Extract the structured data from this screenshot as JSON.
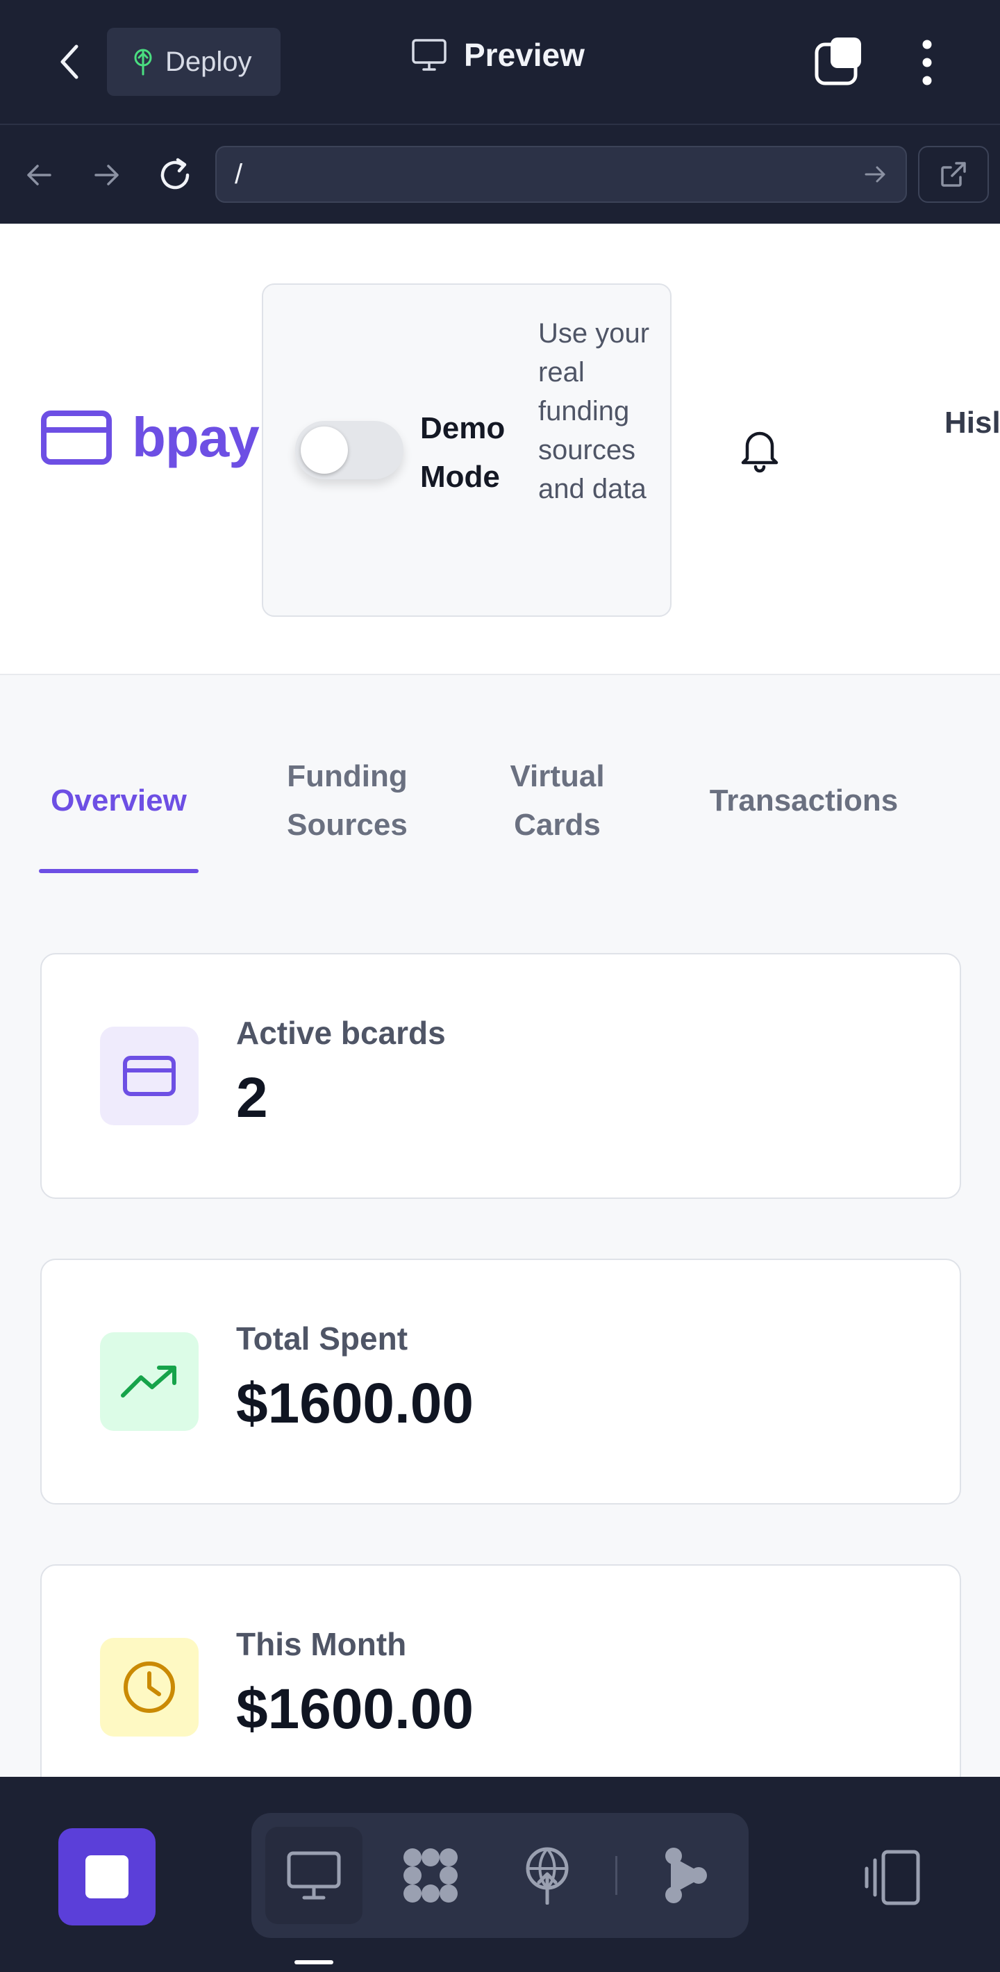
{
  "toolbar": {
    "deploy_label": "Deploy",
    "preview_label": "Preview"
  },
  "browser": {
    "url": "/"
  },
  "app": {
    "brand": "bpay",
    "demo_mode": {
      "label": "Demo Mode",
      "description": "Use your real funding sources and data",
      "enabled": false
    },
    "user_text": "Hisl Bala"
  },
  "tabs": [
    {
      "label": "Overview",
      "active": true
    },
    {
      "label": "Funding Sources",
      "active": false
    },
    {
      "label": "Virtual Cards",
      "active": false
    },
    {
      "label": "Transactions",
      "active": false
    }
  ],
  "stats": [
    {
      "label": "Active bcards",
      "value": "2",
      "icon": "credit-card-icon",
      "color": "#6d4fe4",
      "bg": "#efebfc"
    },
    {
      "label": "Total Spent",
      "value": "$1600.00",
      "icon": "trending-up-icon",
      "color": "#16a34a",
      "bg": "#dcfce7"
    },
    {
      "label": "This Month",
      "value": "$1600.00",
      "icon": "clock-icon",
      "color": "#ca8a04",
      "bg": "#fef9c3"
    }
  ],
  "colors": {
    "accent": "#6d4fe4",
    "chrome": "#1c2133",
    "chrome_surface": "#2c3247"
  }
}
